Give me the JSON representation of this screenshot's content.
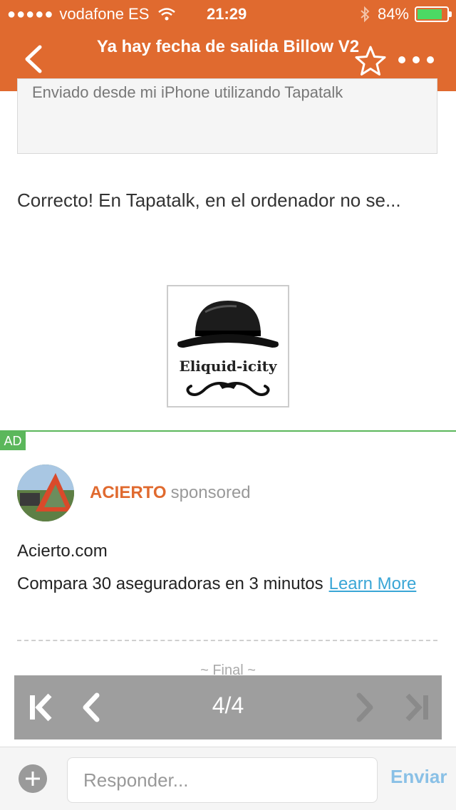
{
  "status_bar": {
    "signal_dots": "●●●●●",
    "carrier": "vodafone ES",
    "time": "21:29",
    "battery_percent": "84%",
    "battery_level": 0.84
  },
  "nav": {
    "title": "Ya hay fecha de salida Billow V2",
    "back_icon": "chevron-left-icon",
    "favorite_icon": "star-outline-icon",
    "more_icon": "more-dots-icon"
  },
  "post": {
    "quoted_text": "Enviado desde mi iPhone utilizando Tapatalk",
    "body": "Correcto! En Tapatalk, en el ordenador no se...",
    "signature_text": "Eliquid-icity"
  },
  "ad": {
    "label": "AD",
    "brand": "ACIERTO",
    "sponsored": "sponsored",
    "site": "Acierto.com",
    "description": "Compara 30 aseguradoras en 3 minutos",
    "cta": "Learn More"
  },
  "thread_end": "~ Final ~",
  "pager": {
    "page_indicator": "4/4"
  },
  "reply": {
    "placeholder": "Responder...",
    "send_label": "Enviar"
  },
  "colors": {
    "header": "#e06a2f",
    "ad_accent": "#5bb75b",
    "link": "#3aa6d6",
    "send": "#89c0e6"
  }
}
